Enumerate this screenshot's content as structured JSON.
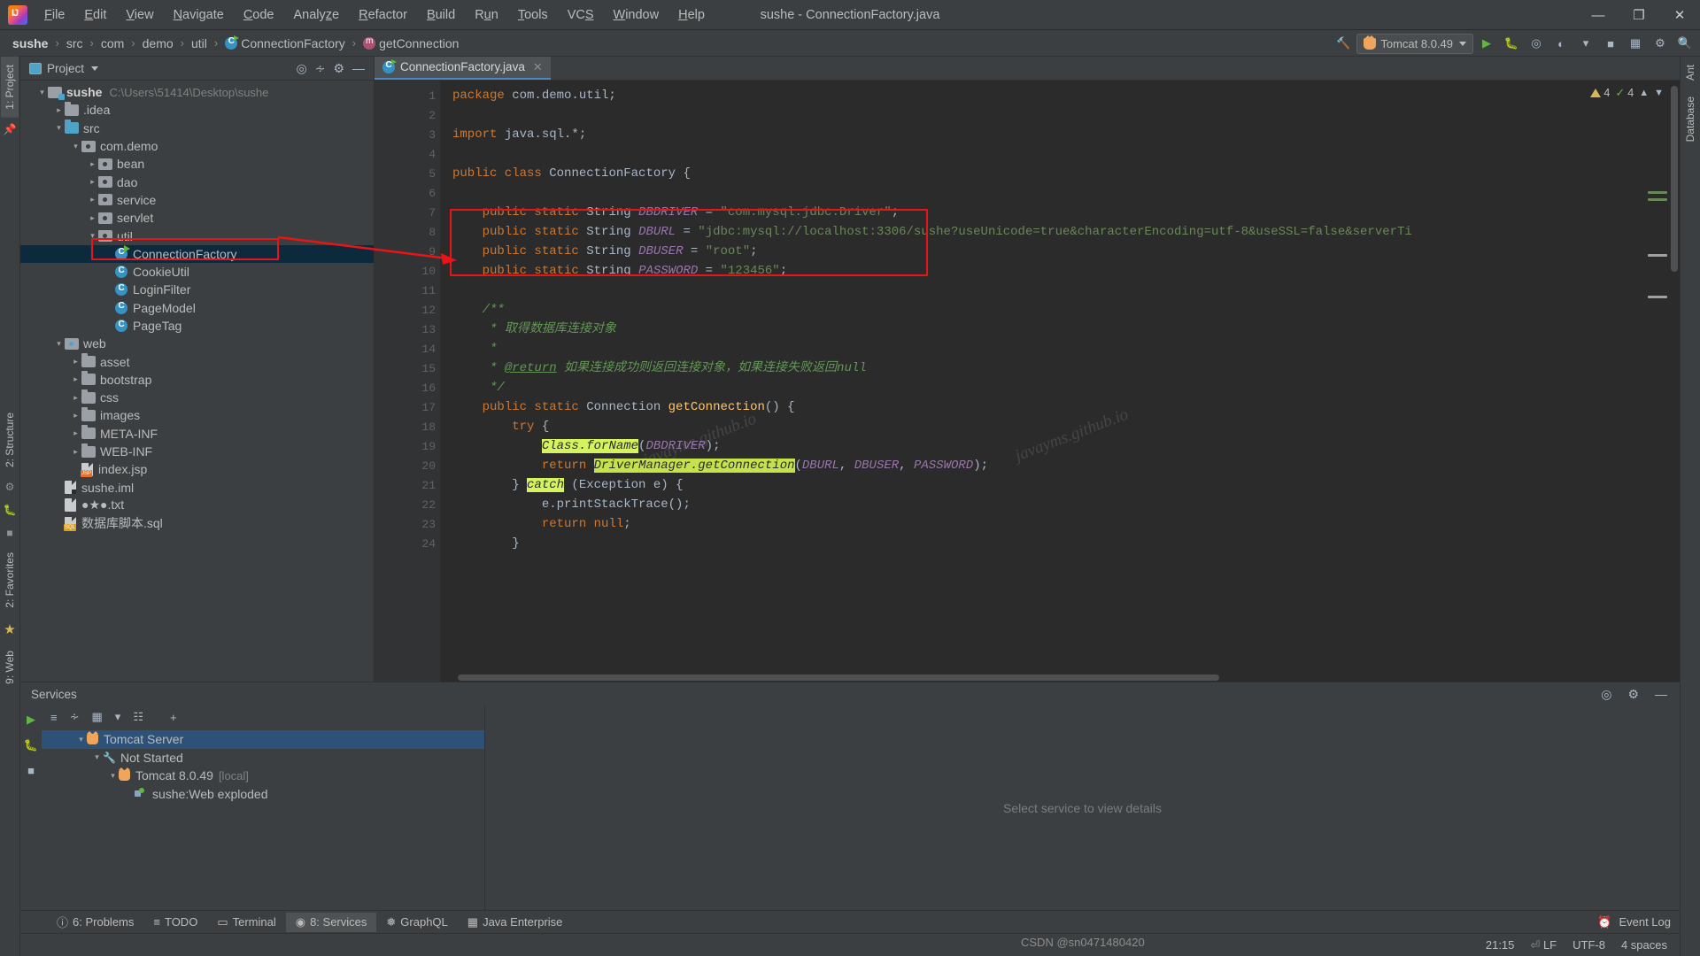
{
  "titlebar": {
    "logo_alt": "IntelliJ IDEA",
    "menus": [
      {
        "label": "File",
        "accel": "F"
      },
      {
        "label": "Edit",
        "accel": "E"
      },
      {
        "label": "View",
        "accel": "V"
      },
      {
        "label": "Navigate",
        "accel": "N"
      },
      {
        "label": "Code",
        "accel": "C"
      },
      {
        "label": "Analyze",
        "accel": "z"
      },
      {
        "label": "Refactor",
        "accel": "R"
      },
      {
        "label": "Build",
        "accel": "B"
      },
      {
        "label": "Run",
        "accel": "u"
      },
      {
        "label": "Tools",
        "accel": "T"
      },
      {
        "label": "VCS",
        "accel": "S"
      },
      {
        "label": "Window",
        "accel": "W"
      },
      {
        "label": "Help",
        "accel": "H"
      }
    ],
    "window_title": "sushe - ConnectionFactory.java",
    "minimize": "—",
    "maximize": "❐",
    "close": "✕"
  },
  "breadcrumb": {
    "items": [
      "sushe",
      "src",
      "com",
      "demo",
      "util",
      "ConnectionFactory",
      "getConnection"
    ],
    "separator": "›"
  },
  "toolbar": {
    "hammer_icon": "build-icon",
    "run_config": "Tomcat 8.0.49",
    "run": "▶",
    "debug": "debug-icon",
    "coverage": "coverage-icon",
    "profile": "profile-icon",
    "stop": "■",
    "layout": "layout-icon",
    "settings": "settings-icon",
    "search": "search-icon"
  },
  "left_strip": {
    "tabs": [
      "1: Project",
      "2: Structure",
      "2: Favorites",
      "9: Web"
    ],
    "icons": [
      "pin-icon",
      "ant-icon",
      "debug-icon",
      "star-icon"
    ]
  },
  "right_strip": {
    "tabs": [
      "Ant",
      "Database"
    ]
  },
  "project_panel": {
    "title": "Project",
    "actions": [
      "locate-icon",
      "collapse-all-icon",
      "gear-icon",
      "hide-icon"
    ],
    "tree": [
      {
        "depth": 0,
        "arrow": "open",
        "icon": "module",
        "label": "sushe",
        "bold": true,
        "path": "C:\\Users\\51414\\Desktop\\sushe"
      },
      {
        "depth": 1,
        "arrow": "closed",
        "icon": "folder-grey",
        "label": ".idea"
      },
      {
        "depth": 1,
        "arrow": "open",
        "icon": "folder-src",
        "label": "src"
      },
      {
        "depth": 2,
        "arrow": "open",
        "icon": "package",
        "label": "com.demo"
      },
      {
        "depth": 3,
        "arrow": "closed",
        "icon": "package",
        "label": "bean"
      },
      {
        "depth": 3,
        "arrow": "closed",
        "icon": "package",
        "label": "dao"
      },
      {
        "depth": 3,
        "arrow": "closed",
        "icon": "package",
        "label": "service"
      },
      {
        "depth": 3,
        "arrow": "closed",
        "icon": "package",
        "label": "servlet"
      },
      {
        "depth": 3,
        "arrow": "open",
        "icon": "package",
        "label": "util"
      },
      {
        "depth": 4,
        "arrow": "none",
        "icon": "class-runnable",
        "label": "ConnectionFactory",
        "selected": true
      },
      {
        "depth": 4,
        "arrow": "none",
        "icon": "class",
        "label": "CookieUtil"
      },
      {
        "depth": 4,
        "arrow": "none",
        "icon": "class",
        "label": "LoginFilter"
      },
      {
        "depth": 4,
        "arrow": "none",
        "icon": "class",
        "label": "PageModel"
      },
      {
        "depth": 4,
        "arrow": "none",
        "icon": "class",
        "label": "PageTag"
      },
      {
        "depth": 1,
        "arrow": "open",
        "icon": "web-dir",
        "label": "web"
      },
      {
        "depth": 2,
        "arrow": "closed",
        "icon": "folder-grey",
        "label": "asset"
      },
      {
        "depth": 2,
        "arrow": "closed",
        "icon": "folder-grey",
        "label": "bootstrap"
      },
      {
        "depth": 2,
        "arrow": "closed",
        "icon": "folder-grey",
        "label": "css"
      },
      {
        "depth": 2,
        "arrow": "closed",
        "icon": "folder-grey",
        "label": "images"
      },
      {
        "depth": 2,
        "arrow": "closed",
        "icon": "folder-grey",
        "label": "META-INF"
      },
      {
        "depth": 2,
        "arrow": "closed",
        "icon": "folder-grey",
        "label": "WEB-INF"
      },
      {
        "depth": 2,
        "arrow": "none",
        "icon": "file-jsp",
        "label": "index.jsp"
      },
      {
        "depth": 1,
        "arrow": "none",
        "icon": "file-iml",
        "label": "sushe.iml"
      },
      {
        "depth": 1,
        "arrow": "none",
        "icon": "file-txt",
        "label": "●★●.txt"
      },
      {
        "depth": 1,
        "arrow": "none",
        "icon": "file-sql",
        "label": "数据库脚本.sql"
      }
    ]
  },
  "editor": {
    "tab": {
      "label": "ConnectionFactory.java",
      "close": "✕",
      "icon": "java-class-icon"
    },
    "inspection": {
      "warnings": "4",
      "checks": "4",
      "caret_up": "⌃",
      "caret_down": "⌄"
    },
    "lines": [
      {
        "n": 1,
        "html": "<span class='k'>package</span> com.demo.util;"
      },
      {
        "n": 2,
        "html": ""
      },
      {
        "n": 3,
        "html": "<span class='k'>import</span> java.sql.*;"
      },
      {
        "n": 4,
        "html": ""
      },
      {
        "n": 5,
        "html": "<span class='k'>public class</span> <span class='ty'>ConnectionFactory</span> {"
      },
      {
        "n": 6,
        "html": ""
      },
      {
        "n": 7,
        "html": "    <span class='k'>public static</span> <span class='ty'>String</span> <span class='f'>DBDRIVER</span> = <span class='s'>\"com.mysql.jdbc.Driver\"</span>;"
      },
      {
        "n": 8,
        "html": "    <span class='k'>public static</span> <span class='ty'>String</span> <span class='f'>DBURL</span> = <span class='s'>\"jdbc:mysql://localhost:3306/sushe?useUnicode=true&amp;characterEncoding=utf-8&amp;useSSL=false&amp;serverTi</span>"
      },
      {
        "n": 9,
        "html": "    <span class='k'>public static</span> <span class='ty'>String</span> <span class='f'>DBUSER</span> = <span class='s'>\"root\"</span>;"
      },
      {
        "n": 10,
        "html": "    <span class='k'>public static</span> <span class='ty'>String</span> <span class='f'>PASSWORD</span> = <span class='s'>\"123456\"</span>;"
      },
      {
        "n": 11,
        "html": ""
      },
      {
        "n": 12,
        "html": "    <span class='cm'>/**</span>"
      },
      {
        "n": 13,
        "html": "     <span class='cm'>* 取得数据库连接对象</span>"
      },
      {
        "n": 14,
        "html": "     <span class='cm'>*</span>"
      },
      {
        "n": 15,
        "html": "     <span class='cm'>* </span><span class='tag2'>@return</span><span class='cm'> 如果连接成功则返回连接对象，如果连接失败返回null</span>"
      },
      {
        "n": 16,
        "html": "     <span class='cm'>*/</span>"
      },
      {
        "n": 17,
        "html": "    <span class='k'>public static</span> <span class='ty'>Connection</span> <span class='mth'>getConnection</span>() {"
      },
      {
        "n": 18,
        "html": "        <span class='k'>try</span> {"
      },
      {
        "n": 19,
        "html": "            <span class='hl'>Class.forName</span>(<span class='f'>DBDRIVER</span>);"
      },
      {
        "n": 20,
        "html": "            <span class='k'>return</span> <span class='hl2'>DriverManager.getConnection</span>(<span class='f'>DBURL</span>, <span class='f'>DBUSER</span>, <span class='f'>PASSWORD</span>);"
      },
      {
        "n": 21,
        "html": "        } <span class='hl'>catch</span> (<span class='ty'>Exception</span> e) {"
      },
      {
        "n": 22,
        "html": "            e.printStackTrace();"
      },
      {
        "n": 23,
        "html": "            <span class='k'>return</span> <span class='k'>null</span>;"
      },
      {
        "n": 24,
        "html": "        }"
      }
    ],
    "gutter_marks": {
      "5": "run-gutter-icon",
      "12": "fold-start-icon",
      "16": "fold-end-icon",
      "17": "override-icon",
      "18": "fold-icon",
      "21": "bulb-icon"
    },
    "watermarks": [
      "javayms.github.io",
      "javayms.github.io"
    ]
  },
  "services": {
    "title": "Services",
    "head_actions": [
      "locate-icon",
      "gear-icon",
      "hide-icon"
    ],
    "toolbar": [
      "run-icon",
      "expand-icon",
      "collapse-icon",
      "group-icon",
      "filter-icon",
      "layout-icon",
      "add-icon"
    ],
    "tree": [
      {
        "depth": 0,
        "arrow": "open",
        "icon": "tomcat-icon",
        "label": "Tomcat Server",
        "selected": true
      },
      {
        "depth": 1,
        "arrow": "open",
        "icon": "wrench-icon",
        "label": "Not Started"
      },
      {
        "depth": 2,
        "arrow": "open",
        "icon": "tomcat-icon",
        "label": "Tomcat 8.0.49",
        "suffix": "[local]"
      },
      {
        "depth": 3,
        "arrow": "none",
        "icon": "deploy-icon",
        "label": "sushe:Web exploded"
      }
    ],
    "detail_placeholder": "Select service to view details"
  },
  "bottom_bar": {
    "items": [
      {
        "label": "6: Problems",
        "accel": "6",
        "icon": "problems-icon"
      },
      {
        "label": "TODO",
        "accel": "",
        "icon": "todo-icon"
      },
      {
        "label": "Terminal",
        "accel": "",
        "icon": "terminal-icon"
      },
      {
        "label": "8: Services",
        "accel": "8",
        "icon": "services-icon",
        "active": true
      },
      {
        "label": "GraphQL",
        "accel": "",
        "icon": "graphql-icon"
      },
      {
        "label": "Java Enterprise",
        "accel": "",
        "icon": "java-enterprise-icon"
      }
    ],
    "event_log": "Event Log"
  },
  "status_bar": {
    "time": "21:15",
    "line_sep": "LF",
    "encoding": "UTF-8",
    "indent": "4 spaces",
    "watermark": "CSDN @sn0471480420"
  },
  "annotations": {
    "red_box_tree": true,
    "red_box_code": true,
    "arrow": true,
    "accent_red": "#e81416"
  }
}
